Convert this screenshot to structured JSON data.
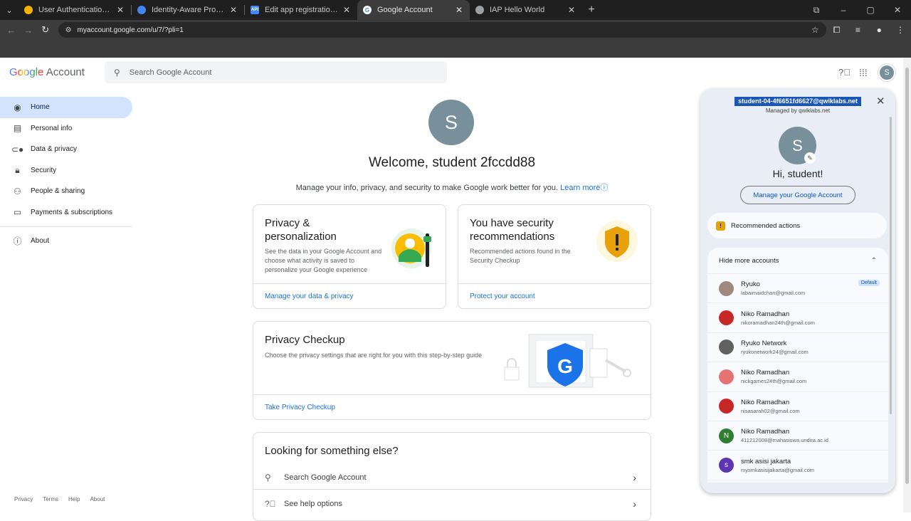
{
  "browser": {
    "tabs": [
      {
        "title": "User Authentication: Identity-A",
        "fav_color": "#f4b400",
        "active": false
      },
      {
        "title": "Identity-Aware Proxy – Security",
        "fav_color": "#4285f4",
        "active": false
      },
      {
        "title": "Edit app registration – APIs & S",
        "fav_color": "#4285f4",
        "active": false
      },
      {
        "title": "Google Account",
        "fav_color": "#ffffff",
        "active": true
      },
      {
        "title": "IAP Hello World",
        "fav_color": "#9aa0a6",
        "active": false
      }
    ],
    "url": "myaccount.google.com/u/7/?pli=1"
  },
  "header": {
    "logo_google": "Google",
    "logo_account": "Account",
    "search_placeholder": "Search Google Account",
    "avatar_letter": "S"
  },
  "sidebar": {
    "items": [
      {
        "label": "Home",
        "icon": "person-circle-icon"
      },
      {
        "label": "Personal info",
        "icon": "id-card-icon"
      },
      {
        "label": "Data & privacy",
        "icon": "toggle-icon"
      },
      {
        "label": "Security",
        "icon": "lock-icon"
      },
      {
        "label": "People & sharing",
        "icon": "people-icon"
      },
      {
        "label": "Payments & subscriptions",
        "icon": "credit-card-icon"
      },
      {
        "label": "About",
        "icon": "info-icon"
      }
    ]
  },
  "footer": {
    "links": [
      "Privacy",
      "Terms",
      "Help",
      "About"
    ]
  },
  "main": {
    "avatar_letter": "S",
    "welcome": "Welcome, student 2fccdd88",
    "subtitle": "Manage your info, privacy, and security to make Google work better for you.",
    "learn_more": "Learn more",
    "card_privacy": {
      "title": "Privacy & personalization",
      "desc": "See the data in your Google Account and choose what activity is saved to personalize your Google experience",
      "link": "Manage your data & privacy"
    },
    "card_security": {
      "title": "You have security recommendations",
      "desc": "Recommended actions found in the Security Checkup",
      "link": "Protect your account"
    },
    "card_checkup": {
      "title": "Privacy Checkup",
      "desc": "Choose the privacy settings that are right for you with this step-by-step guide",
      "link": "Take Privacy Checkup"
    },
    "card_else": {
      "title": "Looking for something else?",
      "row1": "Search Google Account",
      "row2": "See help options"
    }
  },
  "panel": {
    "email": "student-04-4f6651fd6627@qwiklabs.net",
    "managed": "Managed by qwiklabs.net",
    "avatar_letter": "S",
    "greeting": "Hi, student!",
    "manage_button": "Manage your Google Account",
    "recommended": "Recommended actions",
    "hide_accounts": "Hide more accounts",
    "default_badge": "Default",
    "accounts": [
      {
        "name": "Ryuko",
        "email": "labaimaidchan@gmail.com",
        "color": "#a1887f",
        "letter": ""
      },
      {
        "name": "Niko Ramadhan",
        "email": "nikoramadhan24th@gmail.com",
        "color": "#c62828",
        "letter": ""
      },
      {
        "name": "Ryuko Network",
        "email": "ryukonetwork24@gmail.com",
        "color": "#616161",
        "letter": ""
      },
      {
        "name": "Niko Ramadhan",
        "email": "nickgames24th@gmail.com",
        "color": "#e57373",
        "letter": ""
      },
      {
        "name": "Niko Ramadhan",
        "email": "nisasarah02@gmail.com",
        "color": "#c62828",
        "letter": ""
      },
      {
        "name": "Niko Ramadhan",
        "email": "411212008@mahasiswa.undira.ac.id",
        "color": "#2e7d32",
        "letter": "N"
      },
      {
        "name": "smk asisi jakarta",
        "email": "mysmkasisijakarta@gmail.com",
        "color": "#5e35b1",
        "letter": "s"
      }
    ]
  }
}
